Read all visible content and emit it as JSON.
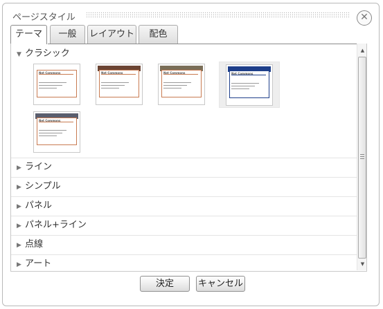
{
  "dialog": {
    "title": "ページスタイル",
    "close_glyph": "✕"
  },
  "tabs": [
    {
      "label": "テーマ",
      "active": true
    },
    {
      "label": "一般",
      "active": false
    },
    {
      "label": "レイアウト",
      "active": false
    },
    {
      "label": "配色",
      "active": false
    }
  ],
  "sections": [
    {
      "label": "クラシック",
      "expanded": true
    },
    {
      "label": "ライン",
      "expanded": false
    },
    {
      "label": "シンプル",
      "expanded": false
    },
    {
      "label": "パネル",
      "expanded": false
    },
    {
      "label": "パネル+ライン",
      "expanded": false
    },
    {
      "label": "点線",
      "expanded": false
    },
    {
      "label": "アート",
      "expanded": false
    }
  ],
  "arrows": {
    "expanded": "▼",
    "collapsed": "▶"
  },
  "thumbnails": [
    {
      "title": "Net Commons",
      "band_color": "#ffffff",
      "selected": false
    },
    {
      "title": "Net Commons",
      "band_color": "#6b4433",
      "selected": false
    },
    {
      "title": "Net Commons",
      "band_color": "#7a6e58",
      "selected": false
    },
    {
      "title": "Net Commons",
      "band_color": "#1e3f8a",
      "selected": true
    },
    {
      "title": "Net Commons",
      "band_color": "#5a5e6e",
      "selected": false
    }
  ],
  "scrollbar": {
    "up": "▲",
    "down": "▼"
  },
  "buttons": {
    "ok": "決定",
    "cancel": "キャンセル"
  }
}
